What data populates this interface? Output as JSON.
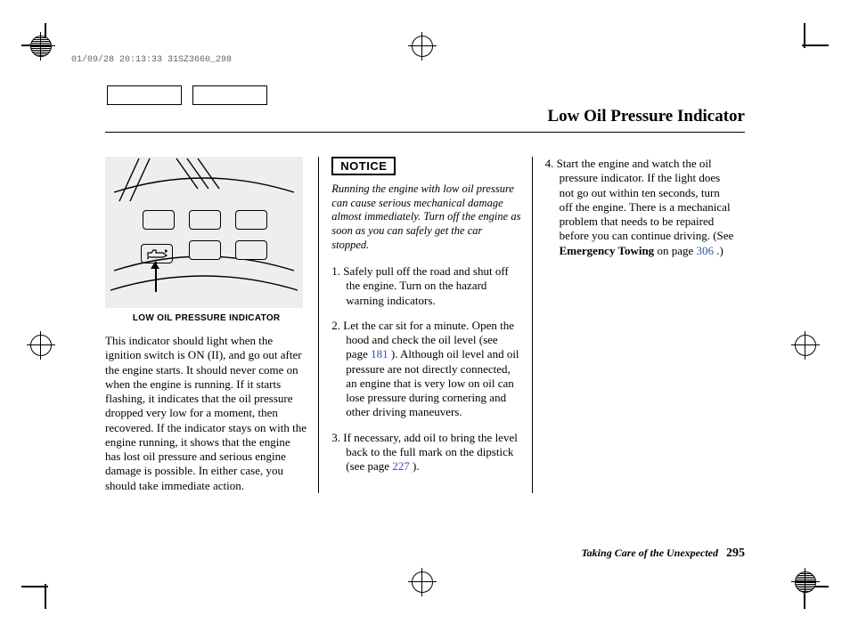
{
  "timestamp": "01/09/28 20:13:33 31SZ3660_298",
  "title": "Low Oil Pressure Indicator",
  "diagram": {
    "caption": "LOW OIL PRESSURE INDICATOR",
    "icon_name": "oil-can"
  },
  "column1_body": "This indicator should light when the ignition switch is ON (II), and go out after the engine starts. It should never come on when the engine is running. If it starts flashing, it indicates that the oil pressure dropped very low for a moment, then recovered. If the indicator stays on with the engine running, it shows that the engine has lost oil pressure and serious engine damage is possible. In either case, you should take immediate action.",
  "notice_label": "NOTICE",
  "notice_text": "Running the engine with low oil pressure can cause serious mechanical damage almost immediately. Turn off the engine as soon as you can safely get the car stopped.",
  "steps": {
    "s1": "Safely pull off the road and shut off the engine. Turn on the hazard warning indicators.",
    "s2a": "Let the car sit for a minute. Open the hood and check the oil level (see page ",
    "s2_link": "181",
    "s2b": " ). Although oil level and oil pressure are not directly connected, an engine that is very low on oil can lose pressure during cornering and other driving maneuvers.",
    "s3a": "If necessary, add oil to bring the level back to the full mark on the dipstick (see page ",
    "s3_link": "227",
    "s3b": " ).",
    "s4a": "Start the engine and watch the oil pressure indicator. If the light does not go out within ten seconds, turn off the engine. There is a mechanical problem that needs to be repaired before you can continue driving. (See ",
    "s4_bold": "Emergency Towing",
    "s4b": " on page ",
    "s4_link": "306",
    "s4c": " .)"
  },
  "footer": {
    "section": "Taking Care of the Unexpected",
    "page": "295"
  }
}
